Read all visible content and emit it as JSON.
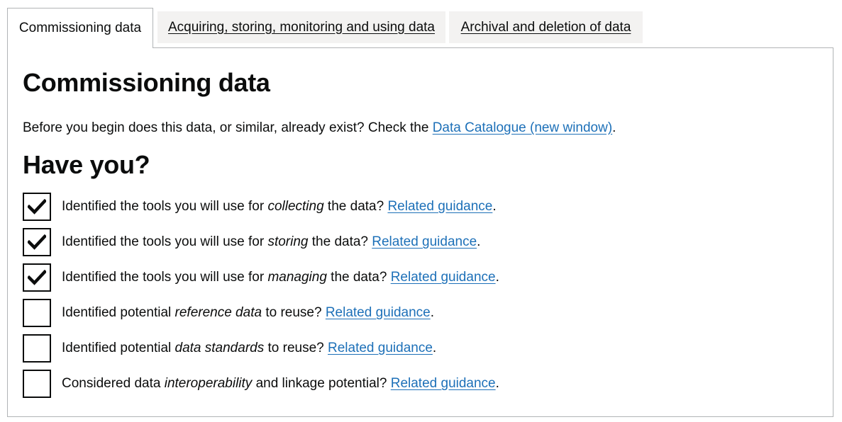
{
  "tabs": [
    {
      "label": "Commissioning data",
      "active": true
    },
    {
      "label": "Acquiring, storing, monitoring and using data",
      "active": false
    },
    {
      "label": "Archival and deletion of data",
      "active": false
    }
  ],
  "panel": {
    "title": "Commissioning data",
    "intro_before": "Before you begin does this data, or similar, already exist? Check the ",
    "intro_link": "Data Catalogue (new window)",
    "intro_after": ".",
    "checklist_heading": "Have you?",
    "items": [
      {
        "checked": true,
        "before": "Identified the tools you will use for ",
        "emph": "collecting",
        "after": " the data? ",
        "link": "Related guidance",
        "end": "."
      },
      {
        "checked": true,
        "before": "Identified the tools you will use for ",
        "emph": "storing",
        "after": " the data? ",
        "link": "Related guidance",
        "end": "."
      },
      {
        "checked": true,
        "before": "Identified the tools you will use for ",
        "emph": "managing",
        "after": " the data? ",
        "link": "Related guidance",
        "end": "."
      },
      {
        "checked": false,
        "before": "Identified potential ",
        "emph": "reference data",
        "after": " to reuse? ",
        "link": "Related guidance",
        "end": "."
      },
      {
        "checked": false,
        "before": "Identified potential ",
        "emph": "data standards",
        "after": " to reuse? ",
        "link": "Related guidance",
        "end": "."
      },
      {
        "checked": false,
        "before": "Considered data ",
        "emph": "interoperability",
        "after": " and linkage potential? ",
        "link": "Related guidance",
        "end": "."
      }
    ]
  },
  "colors": {
    "link": "#1d70b8",
    "text": "#0b0c0c",
    "tab_bg": "#f3f2f1",
    "border": "#b1b4b6"
  }
}
